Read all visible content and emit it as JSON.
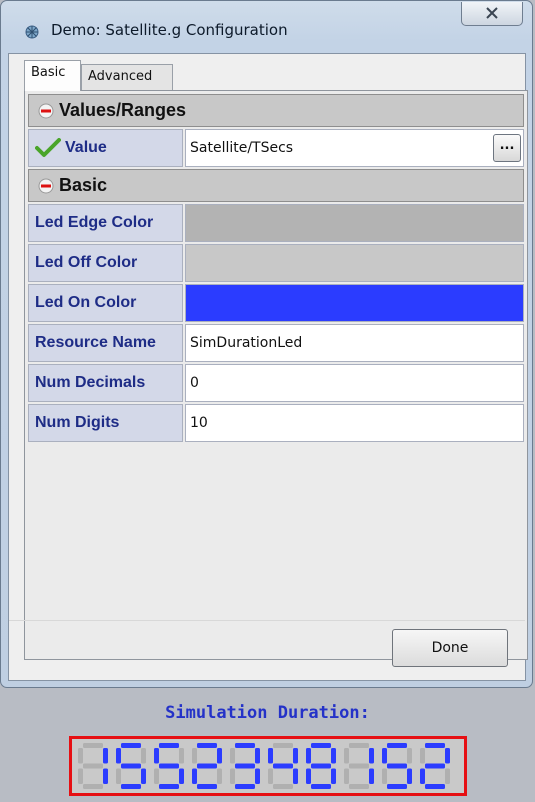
{
  "window": {
    "title": "Demo: Satellite.g Configuration",
    "close_icon": "close-x-icon"
  },
  "tabs": [
    {
      "label": "Basic",
      "active": true
    },
    {
      "label": "Advanced",
      "active": false
    }
  ],
  "sections": {
    "values_ranges": "Values/Ranges",
    "basic": "Basic"
  },
  "properties": {
    "value": {
      "label": "Value",
      "value": "Satellite/TSecs",
      "browse_label": "..."
    },
    "led_edge_color": {
      "label": "Led Edge Color",
      "color": "#b3b3b3"
    },
    "led_off_color": {
      "label": "Led Off Color",
      "color": "#c8c8c8"
    },
    "led_on_color": {
      "label": "Led On Color",
      "color": "#2b3cff"
    },
    "resource_name": {
      "label": "Resource Name",
      "value": "SimDurationLed"
    },
    "num_decimals": {
      "label": "Num Decimals",
      "value": "0"
    },
    "num_digits": {
      "label": "Num Digits",
      "value": "10"
    }
  },
  "buttons": {
    "done": "Done"
  },
  "display": {
    "caption": "Simulation Duration:",
    "value": "1552348152",
    "border_color": "#e60f13",
    "on_color": "#2b3cff",
    "off_color": "#b0b0b0"
  }
}
